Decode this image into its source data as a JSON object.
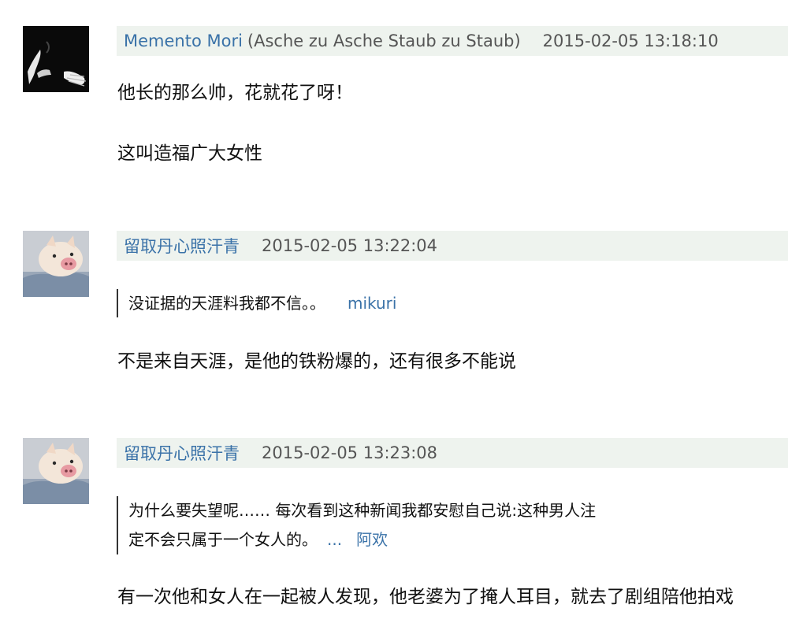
{
  "comments": [
    {
      "author": "Memento Mori",
      "alias": "(Asche zu Asche Staub zu Staub)",
      "time": "2015-02-05 13:18:10",
      "paragraphs": [
        "他长的那么帅，花就花了呀！",
        "这叫造福广大女性"
      ]
    },
    {
      "author": "留取丹心照汗青",
      "time": "2015-02-05 13:22:04",
      "quote": {
        "text": "没证据的天涯料我都不信。。",
        "author": "mikuri"
      },
      "paragraphs": [
        "不是来自天涯，是他的铁粉爆的，还有很多不能说"
      ]
    },
    {
      "author": "留取丹心照汗青",
      "time": "2015-02-05 13:23:08",
      "quote": {
        "line1": "为什么要失望呢…… 每次看到这种新闻我都安慰自己说:这种男人注",
        "line2": "定不会只属于一个女人的。",
        "more": "...",
        "author": "阿欢"
      },
      "paragraphs": [
        "有一次他和女人在一起被人发现，他老婆为了掩人耳目，就去了剧组陪他拍戏"
      ]
    }
  ]
}
